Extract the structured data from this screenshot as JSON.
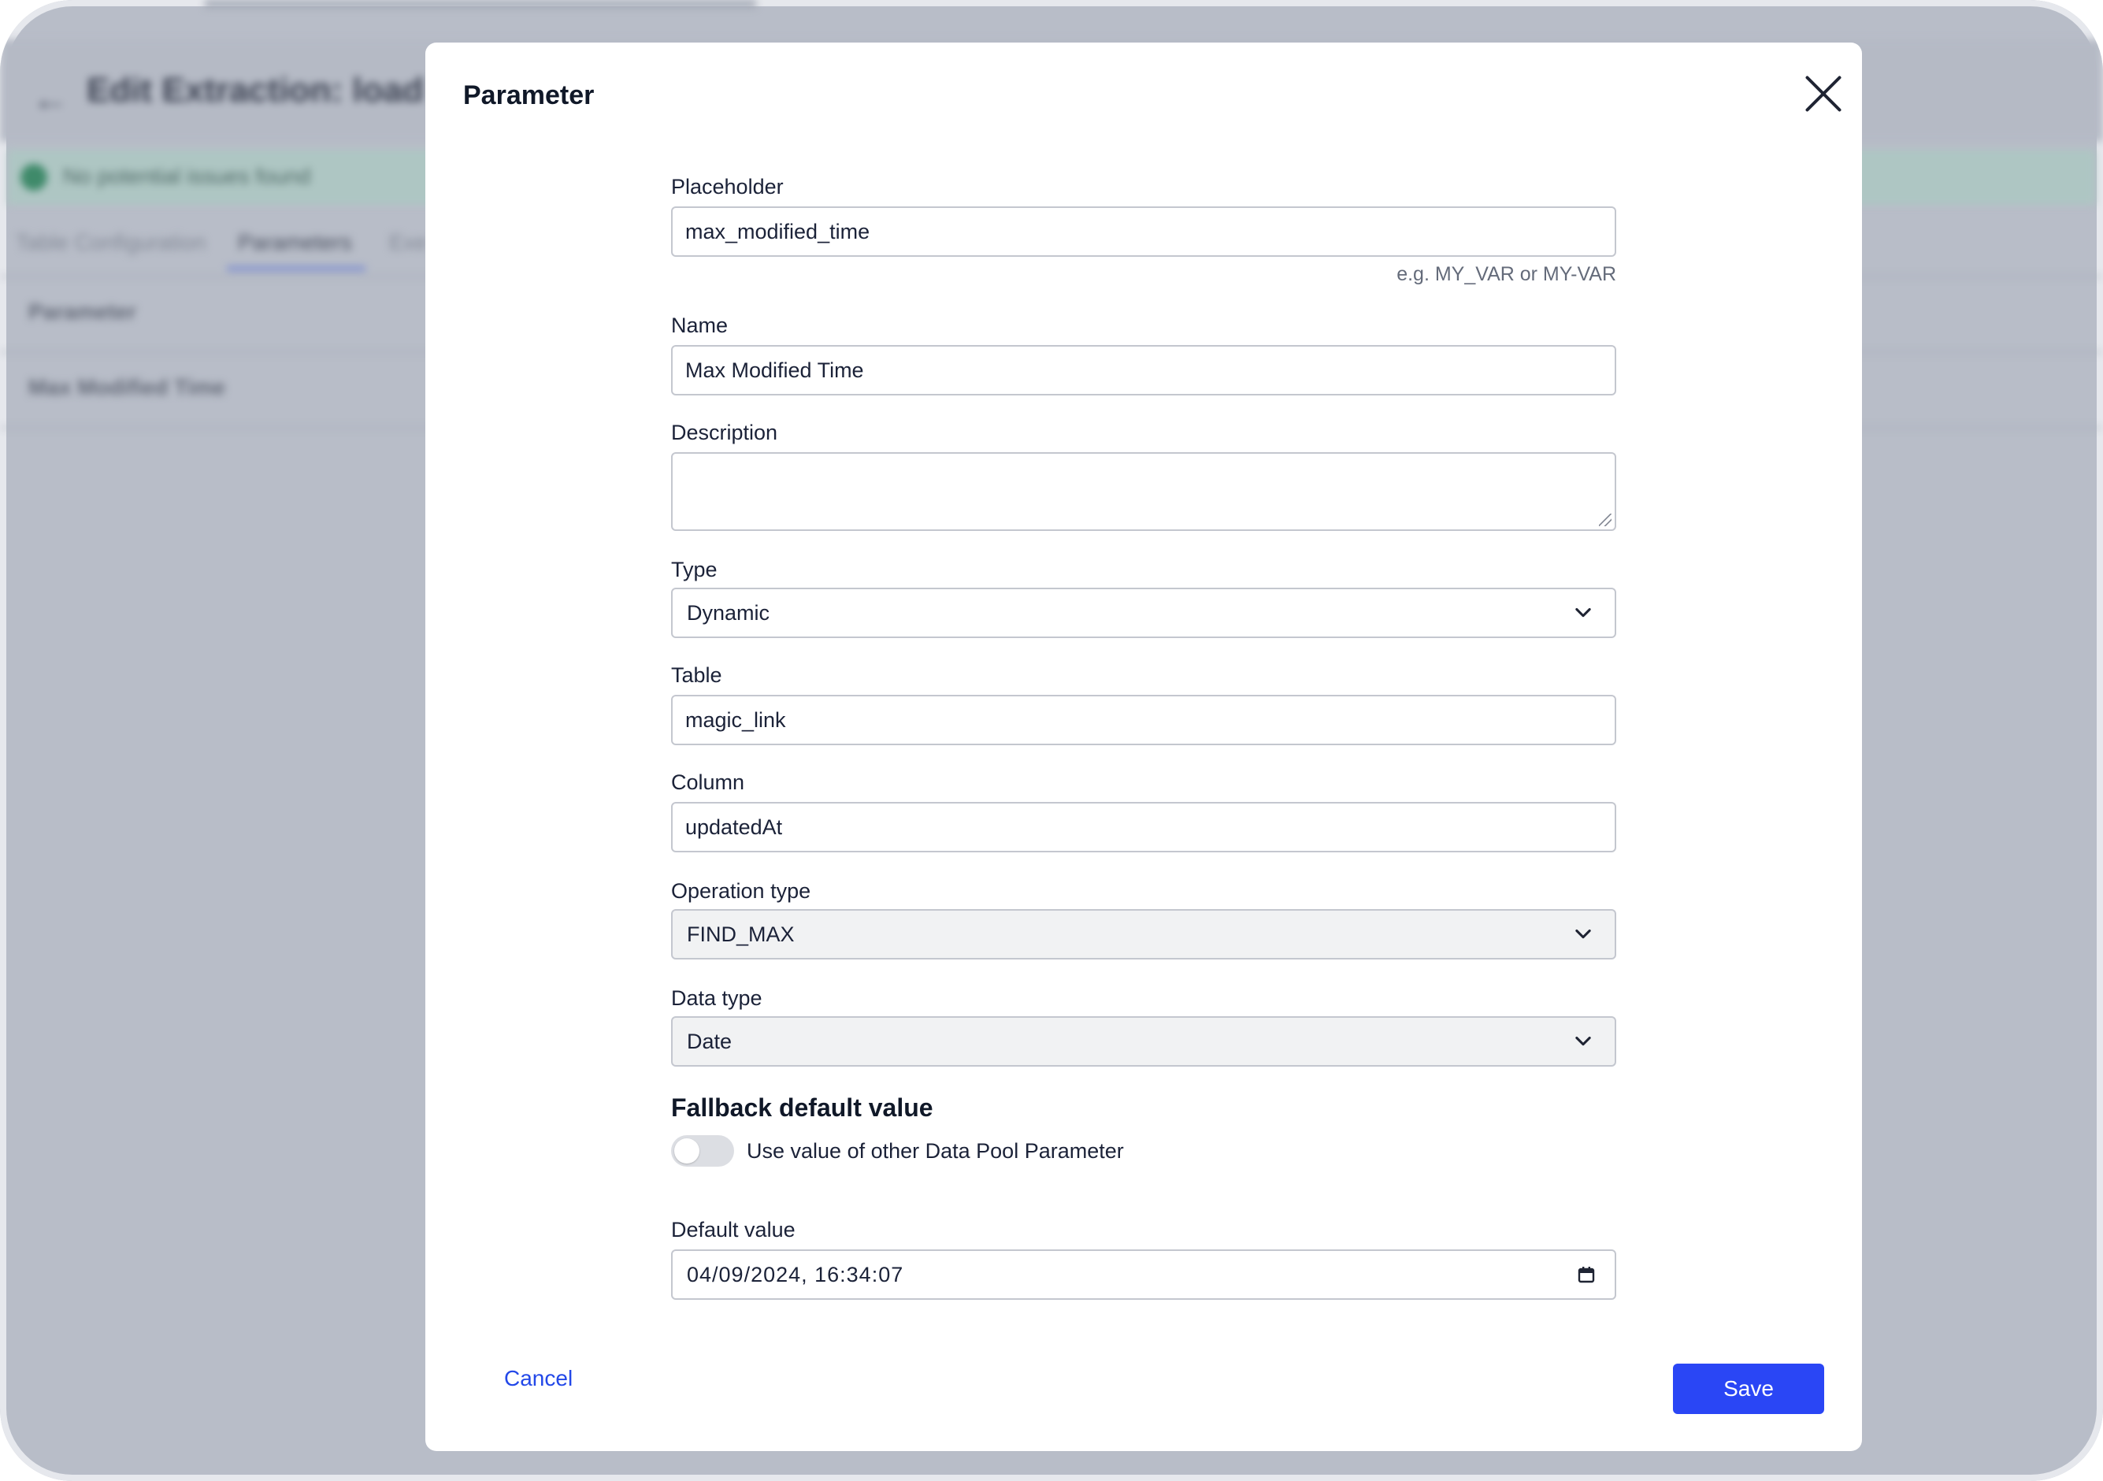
{
  "background": {
    "page_title": "Edit Extraction: load th",
    "alert_text": "No potential issues found",
    "tabs": [
      {
        "label": "Table Configuration"
      },
      {
        "label": "Parameters"
      },
      {
        "label": "Exe"
      }
    ],
    "table_header": "Parameter",
    "table_row": "Max Modified Time"
  },
  "modal": {
    "title": "Parameter",
    "placeholder": {
      "label": "Placeholder",
      "value": "max_modified_time",
      "hint": "e.g. MY_VAR or MY-VAR"
    },
    "name": {
      "label": "Name",
      "value": "Max Modified Time"
    },
    "description": {
      "label": "Description",
      "value": ""
    },
    "type": {
      "label": "Type",
      "value": "Dynamic"
    },
    "table": {
      "label": "Table",
      "value": "magic_link"
    },
    "column": {
      "label": "Column",
      "value": "updatedAt"
    },
    "operation_type": {
      "label": "Operation type",
      "value": "FIND_MAX"
    },
    "data_type": {
      "label": "Data type",
      "value": "Date"
    },
    "fallback": {
      "section_title": "Fallback default value",
      "toggle_label": "Use value of other Data Pool Parameter",
      "toggle_on": false
    },
    "default_value": {
      "label": "Default value",
      "value": "04/09/2024, 16:34:07"
    },
    "cancel_label": "Cancel",
    "save_label": "Save"
  },
  "colors": {
    "primary": "#2a46f5",
    "link": "#2348e8",
    "overlay": "#b8bdc8"
  }
}
